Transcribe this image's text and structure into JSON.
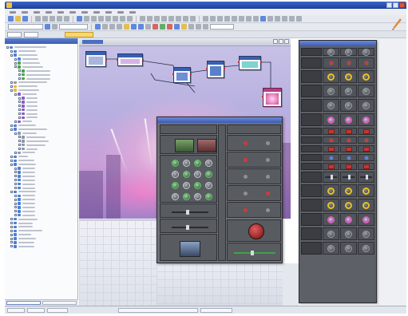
{
  "window": {
    "title": ""
  },
  "menubar": {
    "items": [
      "",
      "",
      "",
      "",
      "",
      "",
      "",
      "",
      "",
      "",
      ""
    ]
  },
  "toolbar": {
    "combo_1": "",
    "combo_2": "",
    "combo_3": ""
  },
  "address": {
    "active_tab": ""
  },
  "component_tree": {
    "title": "",
    "items": []
  },
  "left_tabs": [
    "",
    ""
  ],
  "canvas": {
    "title": ""
  },
  "knob_panel": {
    "title": "",
    "row_labels": []
  },
  "control_panel": {
    "title": "",
    "section_left": "",
    "section_right": ""
  },
  "statusbar": {
    "fields": [
      "",
      "",
      "",
      "",
      ""
    ]
  },
  "colors": {
    "title_bar": "#1d3f9a",
    "accent_tab": "#f7d770",
    "panel_dark": "#5d6066",
    "knob_yellow": "#e6c228",
    "knob_pink": "#d85fb8",
    "led_red": "#c93a3a",
    "node_selected": "#d84a9a"
  },
  "icons": {
    "logo": "brush-logo-icon",
    "tree_expand": "plus-box-icon",
    "window_close": "close-icon",
    "window_minimize": "minimize-icon",
    "window_maximize": "maximize-icon"
  }
}
